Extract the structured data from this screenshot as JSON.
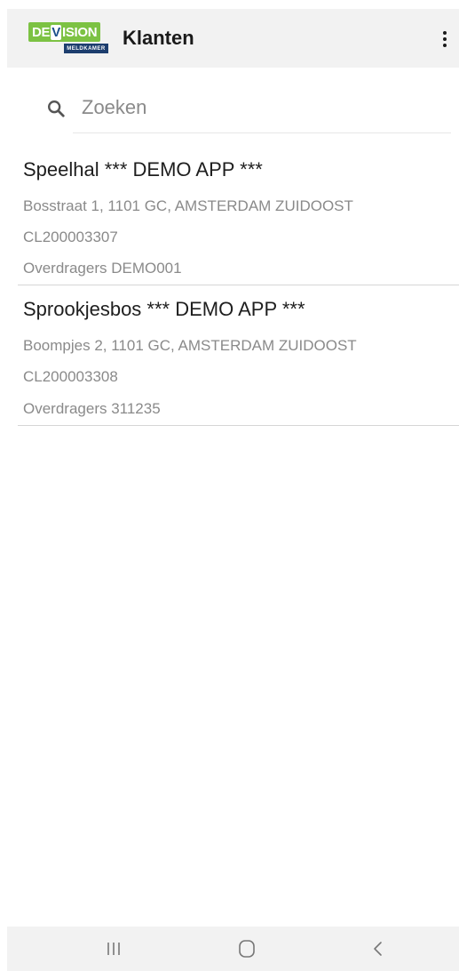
{
  "app_bar": {
    "logo": {
      "text_main": "DEVISION",
      "text_sub": "MELDKAMER",
      "green": "#7cc243",
      "navy": "#1d3e6e"
    },
    "title": "Klanten",
    "overflow_icon": "more-vert-icon"
  },
  "search": {
    "placeholder": "Zoeken",
    "value": "",
    "icon": "search-icon"
  },
  "customers": [
    {
      "name": "Speelhal  *** DEMO APP ***",
      "address": "Bosstraat 1, 1101 GC, AMSTERDAM ZUIDOOST",
      "code": "CL200003307",
      "transmitters": "Overdragers DEMO001"
    },
    {
      "name": "Sprookjesbos *** DEMO APP ***",
      "address": "Boompjes 2, 1101 GC, AMSTERDAM ZUIDOOST",
      "code": "CL200003308",
      "transmitters": "Overdragers 311235"
    }
  ],
  "nav_bar": {
    "buttons": [
      "recent-apps-icon",
      "home-icon",
      "back-icon"
    ]
  },
  "colors": {
    "bar_bg": "#f2f2f2",
    "text_primary": "#1e1e1e",
    "text_secondary": "#8a8a8a",
    "divider": "#d6d6d6"
  }
}
